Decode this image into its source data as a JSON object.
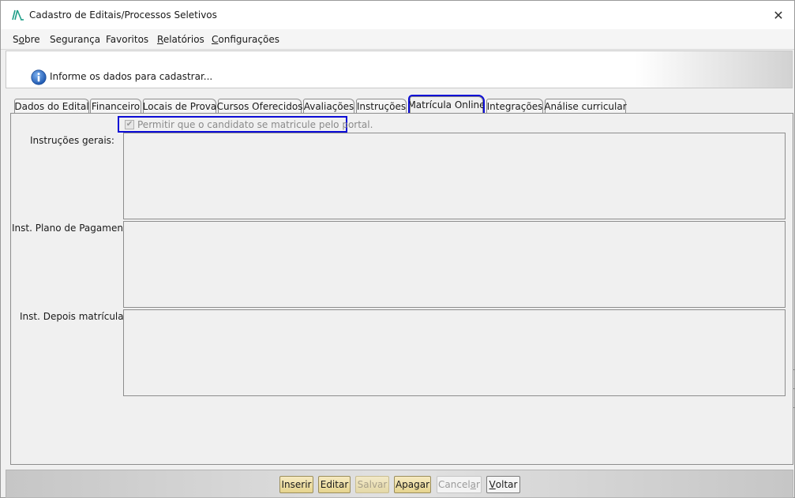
{
  "window": {
    "title": "Cadastro de Editais/Processos Seletivos",
    "close_symbol": "✕",
    "logo_icon": "app-logo-icon"
  },
  "menu": [
    {
      "pre": "S",
      "u": "o",
      "post": "bre"
    },
    {
      "pre": "",
      "u": "",
      "post": "Segurança"
    },
    {
      "pre": "",
      "u": "",
      "post": "Favoritos"
    },
    {
      "pre": "",
      "u": "R",
      "post": "elatórios"
    },
    {
      "pre": "",
      "u": "C",
      "post": "onfigurações"
    }
  ],
  "info": {
    "icon": "info-icon",
    "text": "Informe os dados para cadastrar..."
  },
  "tabs": [
    {
      "label": "Dados do Edital",
      "active": false
    },
    {
      "label": "Financeiro",
      "active": false
    },
    {
      "label": "Locais de Prova",
      "active": false
    },
    {
      "label": "Cursos Oferecidos",
      "active": false
    },
    {
      "label": "Avaliações",
      "active": false
    },
    {
      "label": "Instruções",
      "active": false
    },
    {
      "label": "Matrícula Online",
      "active": true
    },
    {
      "label": "Integrações",
      "active": false
    },
    {
      "label": "Análise curricular",
      "active": false
    }
  ],
  "checkbox": {
    "label": "Permitir que o candidato se matricule pelo portal.",
    "checked": true,
    "disabled": true,
    "check_glyph": "✔"
  },
  "fields": [
    {
      "label": "Instruções gerais:",
      "value": ""
    },
    {
      "label": "Inst. Plano de Pagamento:",
      "value": ""
    },
    {
      "label": "Inst. Depois matrícula:",
      "value": ""
    }
  ],
  "buttons": [
    {
      "pre": "",
      "u": "",
      "post": "Inserir",
      "style": "gold"
    },
    {
      "pre": "",
      "u": "",
      "post": "Editar",
      "style": "gold"
    },
    {
      "pre": "",
      "u": "",
      "post": "Salvar",
      "style": "gold-disabled"
    },
    {
      "pre": "",
      "u": "",
      "post": "Apagar",
      "style": "gold"
    },
    {
      "pre": "Cancel",
      "u": "a",
      "post": "r",
      "style": "plain-disabled"
    },
    {
      "pre": "",
      "u": "V",
      "post": "oltar",
      "style": "plain"
    }
  ],
  "colors": {
    "highlight": "#0b0bd6",
    "window_bg": "#f0f0f0",
    "logo_green": "#1f9e89",
    "info_blue": "#2f6fc8"
  }
}
